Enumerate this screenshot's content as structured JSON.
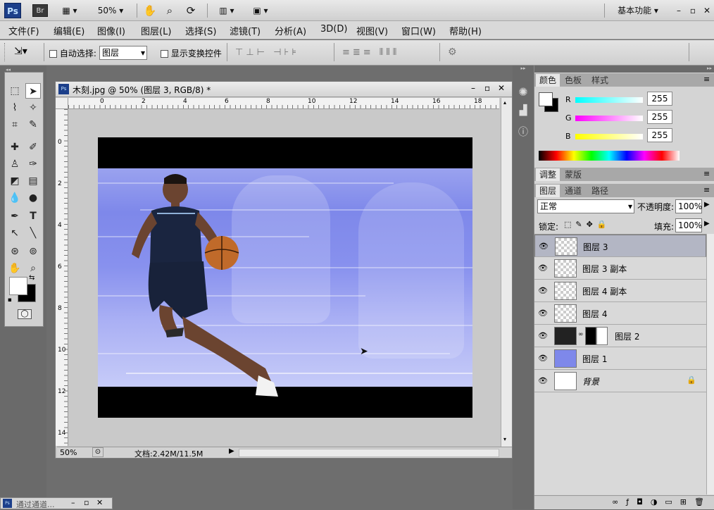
{
  "appbar": {
    "ps": "Ps",
    "br": "Br",
    "zoom": "50%",
    "workspace": "基本功能"
  },
  "menus": [
    "文件(F)",
    "编辑(E)",
    "图像(I)",
    "图层(L)",
    "选择(S)",
    "滤镜(T)",
    "分析(A)",
    "3D(D)",
    "视图(V)",
    "窗口(W)",
    "帮助(H)"
  ],
  "options": {
    "auto_select_label": "自动选择:",
    "auto_select_value": "图层",
    "show_transform_label": "显示变换控件"
  },
  "document": {
    "title": "木刻.jpg @ 50% (图层 3, RGB/8) *",
    "zoom": "50%",
    "doc_info": "文档:2.42M/11.5M",
    "ruler_h": [
      "0",
      "2",
      "4",
      "6",
      "8",
      "10",
      "12",
      "14",
      "16",
      "18"
    ],
    "ruler_v": [
      "0",
      "2",
      "4",
      "6",
      "8",
      "10",
      "12",
      "14"
    ]
  },
  "color_panel": {
    "tabs": [
      "颜色",
      "色板",
      "样式"
    ],
    "r_label": "R",
    "g_label": "G",
    "b_label": "B",
    "r": "255",
    "g": "255",
    "b": "255"
  },
  "adjust_tabs": [
    "调整",
    "蒙版"
  ],
  "layers_panel": {
    "tabs": [
      "图层",
      "通道",
      "路径"
    ],
    "blend": "正常",
    "opacity_label": "不透明度:",
    "opacity": "100%",
    "lock_label": "锁定:",
    "fill_label": "填充:",
    "fill": "100%",
    "layers": [
      "图层 3",
      "图层 3 副本",
      "图层 4 副本",
      "图层 4",
      "图层 2",
      "图层 1",
      "背景"
    ]
  },
  "mini_doc": {
    "title": "通过通道..."
  }
}
